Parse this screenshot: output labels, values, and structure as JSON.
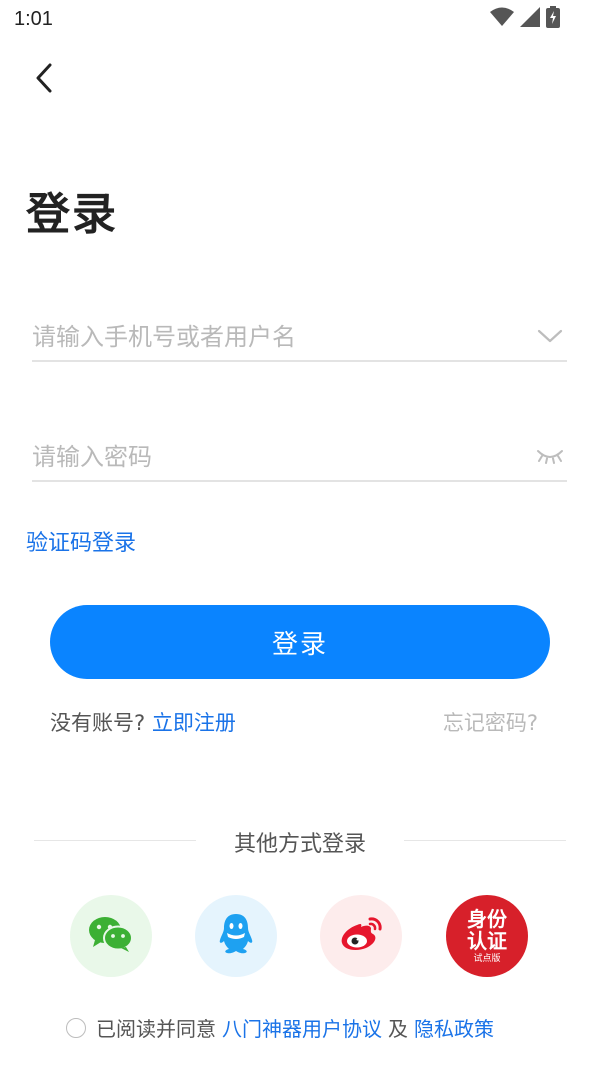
{
  "status_bar": {
    "time": "1:01"
  },
  "page": {
    "title": "登录"
  },
  "form": {
    "username_placeholder": "请输入手机号或者用户名",
    "password_placeholder": "请输入密码",
    "code_login_label": "验证码登录",
    "login_button_label": "登录"
  },
  "account": {
    "no_account_text": "没有账号?",
    "register_label": "立即注册",
    "forgot_label": "忘记密码?"
  },
  "other_login": {
    "label": "其他方式登录",
    "items": [
      {
        "icon": "wechat-icon"
      },
      {
        "icon": "qq-icon"
      },
      {
        "icon": "weibo-icon"
      },
      {
        "icon": "id-verify-icon",
        "text": "身份认证",
        "sub": "试点版"
      }
    ]
  },
  "agreement": {
    "prefix": "已阅读并同意",
    "user_agreement": "八门神器用户协议",
    "and": "及",
    "privacy_policy": "隐私政策"
  },
  "colors": {
    "accent": "#0a84ff",
    "link": "#1a73e8",
    "id_red": "#d7202a"
  }
}
